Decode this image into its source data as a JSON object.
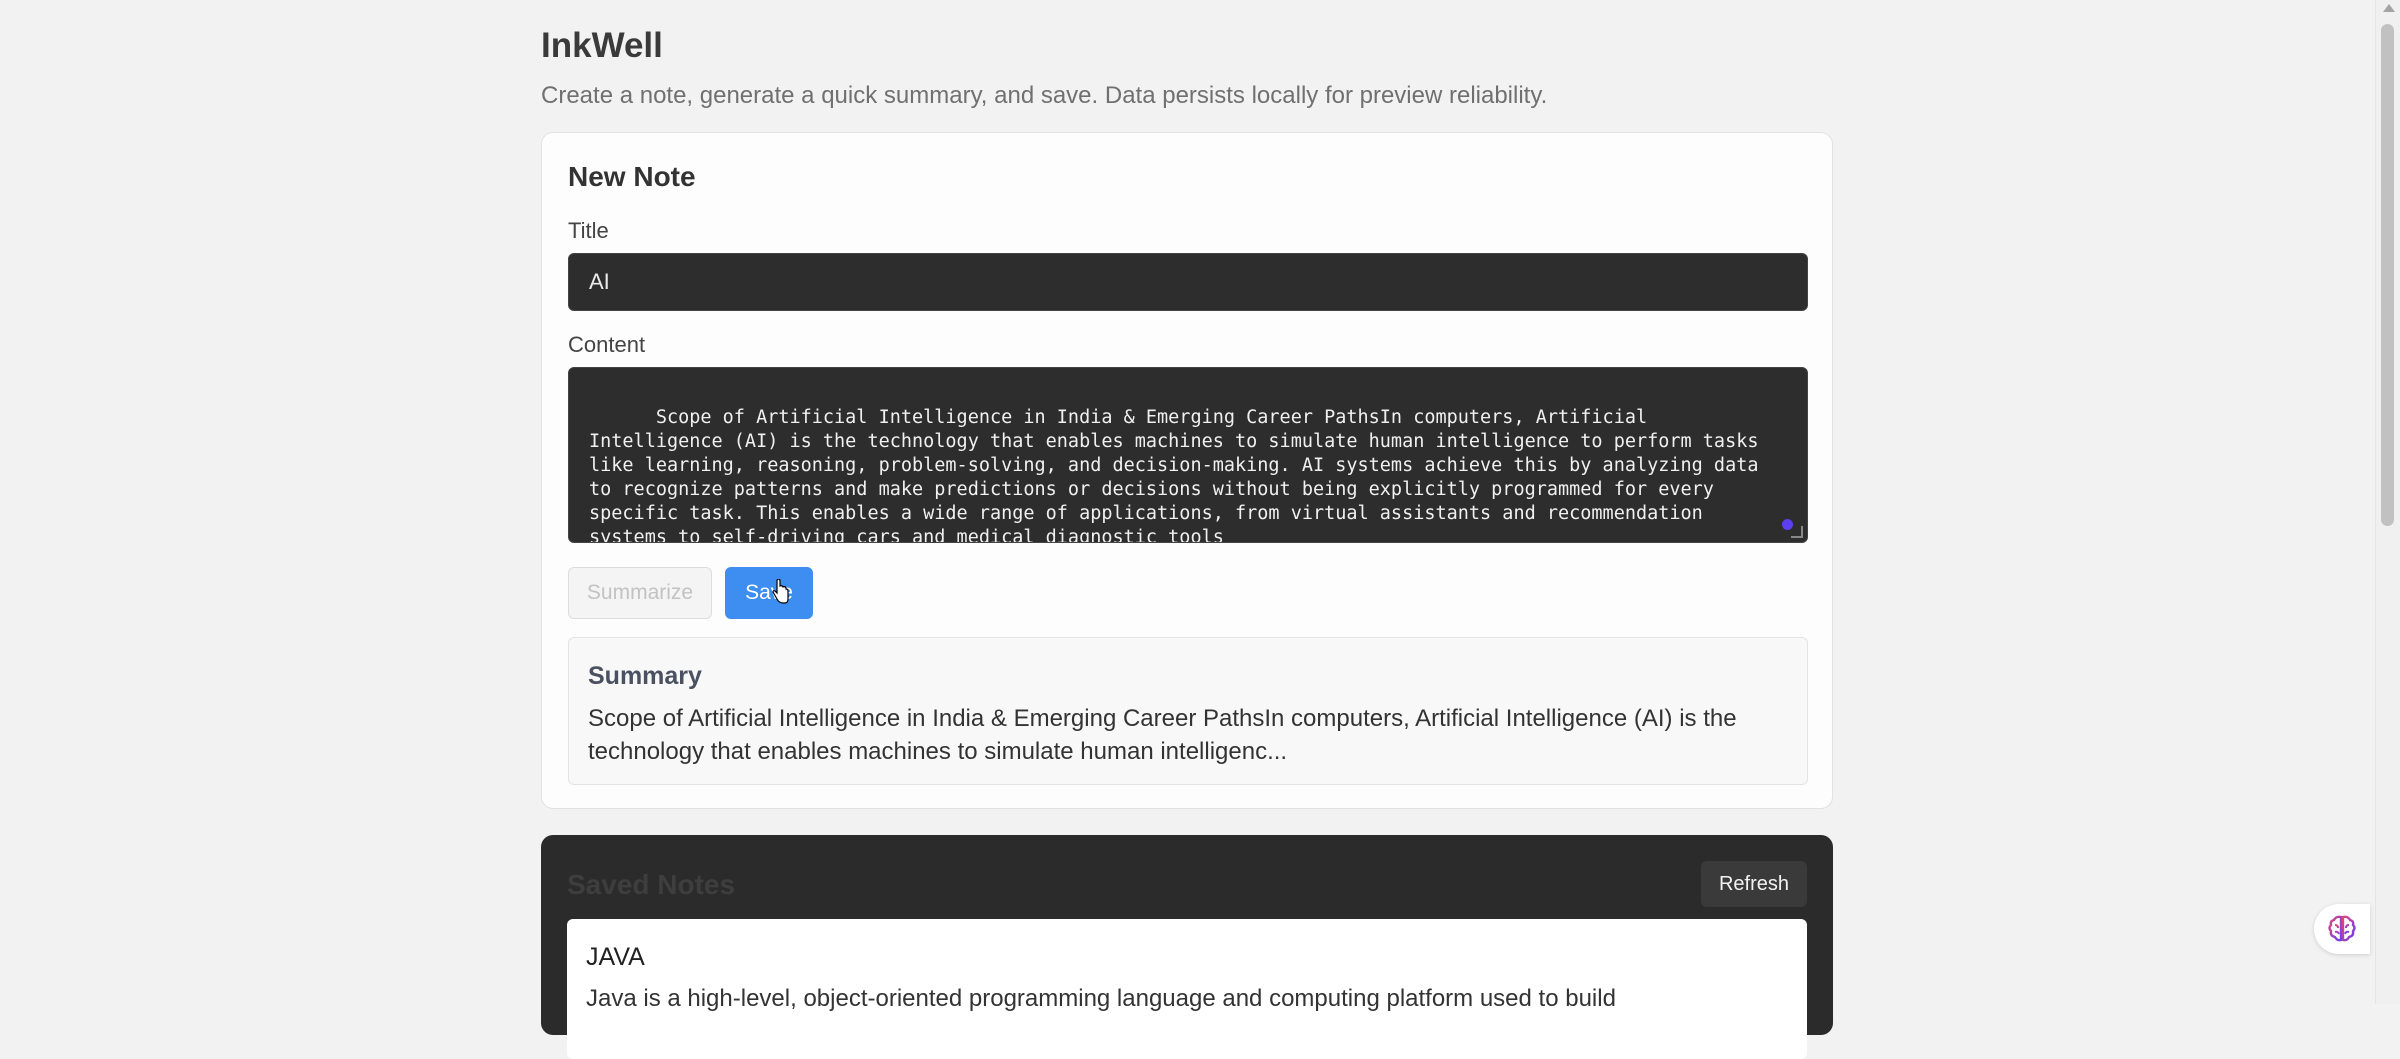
{
  "header": {
    "title": "InkWell",
    "subtitle": "Create a note, generate a quick summary, and save. Data persists locally for preview reliability."
  },
  "new_note": {
    "heading": "New Note",
    "title_label": "Title",
    "title_value": "AI",
    "content_label": "Content",
    "content_value": "Scope of Artificial Intelligence in India & Emerging Career PathsIn computers, Artificial Intelligence (AI) is the technology that enables machines to simulate human intelligence to perform tasks like learning, reasoning, problem-solving, and decision-making. AI systems achieve this by analyzing data to recognize patterns and make predictions or decisions without being explicitly programmed for every specific task. This enables a wide range of applications, from virtual assistants and recommendation systems to self-driving cars and medical diagnostic tools",
    "summarize_label": "Summarize",
    "save_label": "Save"
  },
  "summary": {
    "heading": "Summary",
    "text": "Scope of Artificial Intelligence in India & Emerging Career PathsIn computers, Artificial Intelligence (AI) is the technology that enables machines to simulate human intelligenc..."
  },
  "saved_notes": {
    "heading": "Saved Notes",
    "refresh_label": "Refresh",
    "items": [
      {
        "title": "JAVA",
        "preview": "Java is a high-level, object-oriented programming language and computing platform used to build"
      }
    ]
  },
  "colors": {
    "accent": "#3d8ef0",
    "input_bg": "#2d2d2d",
    "page_bg": "#f2f2f2"
  }
}
